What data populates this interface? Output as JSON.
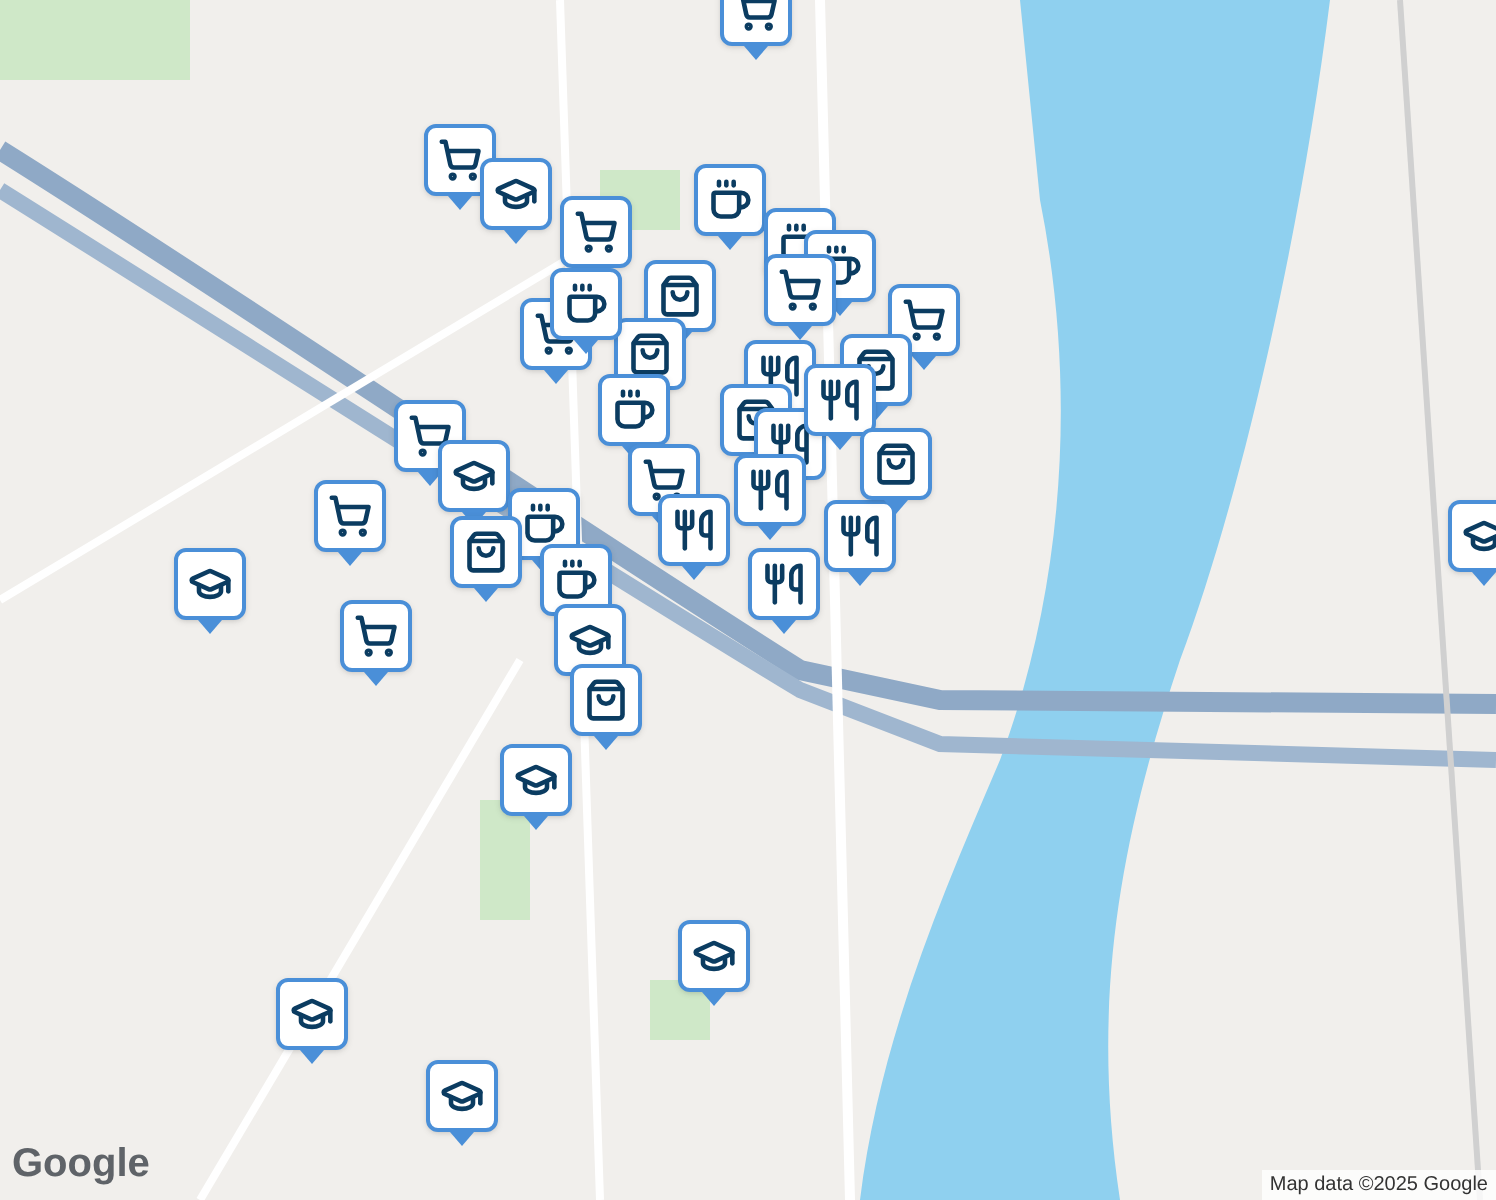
{
  "map": {
    "markers": [
      {
        "kind": "cart"
      },
      {
        "kind": "cart"
      },
      {
        "kind": "cap"
      },
      {
        "kind": "coffee"
      },
      {
        "kind": "coffee"
      },
      {
        "kind": "coffee"
      },
      {
        "kind": "bag"
      },
      {
        "kind": "cart"
      },
      {
        "kind": "cart"
      },
      {
        "kind": "cart"
      },
      {
        "kind": "bag"
      },
      {
        "kind": "coffee"
      },
      {
        "kind": "cart"
      },
      {
        "kind": "bag"
      },
      {
        "kind": "utensils"
      },
      {
        "kind": "coffee"
      },
      {
        "kind": "bag"
      },
      {
        "kind": "utensils"
      },
      {
        "kind": "utensils"
      },
      {
        "kind": "utensils"
      },
      {
        "kind": "cart"
      },
      {
        "kind": "cap"
      },
      {
        "kind": "cart"
      },
      {
        "kind": "utensils"
      },
      {
        "kind": "bag"
      },
      {
        "kind": "utensils"
      },
      {
        "kind": "cart"
      },
      {
        "kind": "coffee"
      },
      {
        "kind": "bag"
      },
      {
        "kind": "cap"
      },
      {
        "kind": "coffee"
      },
      {
        "kind": "cart"
      },
      {
        "kind": "utensils"
      },
      {
        "kind": "cap"
      },
      {
        "kind": "bag"
      },
      {
        "kind": "cap"
      },
      {
        "kind": "cap"
      },
      {
        "kind": "cap"
      },
      {
        "kind": "cap"
      },
      {
        "kind": "cap"
      }
    ]
  },
  "attribution": {
    "logo": "Google",
    "text": "Map data ©2025 Google"
  }
}
